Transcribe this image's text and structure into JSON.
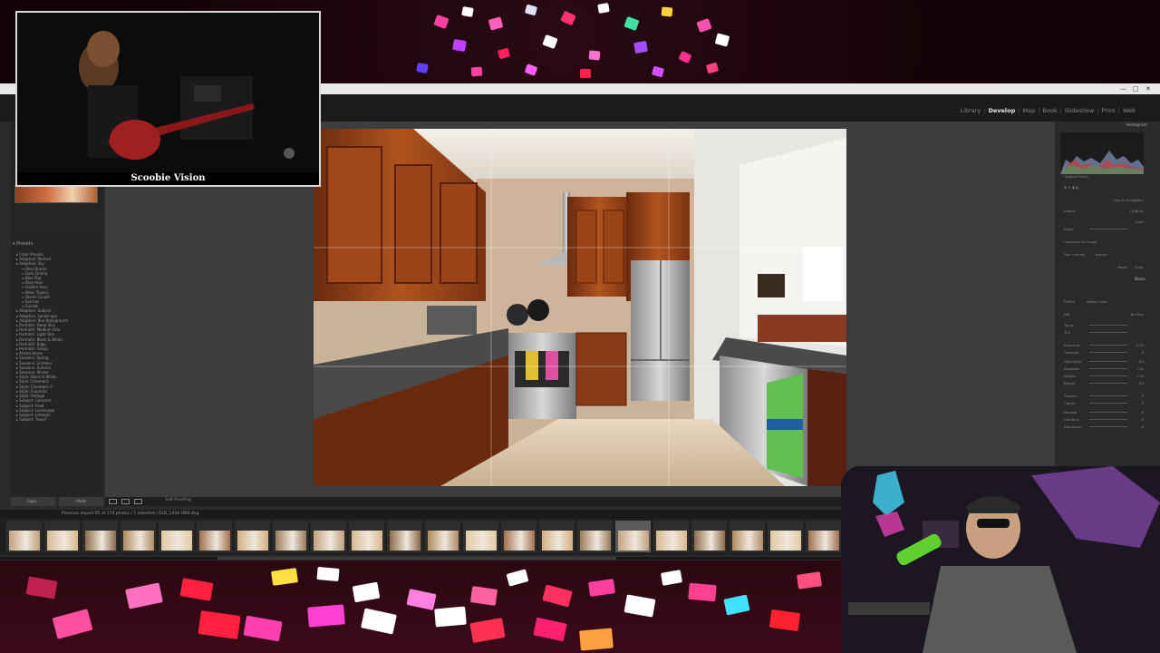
{
  "overlay": {
    "bass_cam_label": "Scoobie Vision"
  },
  "lightroom": {
    "modules": [
      {
        "label": "Library",
        "active": false
      },
      {
        "label": "Develop",
        "active": true
      },
      {
        "label": "Map",
        "active": false
      },
      {
        "label": "Book",
        "active": false
      },
      {
        "label": "Slideshow",
        "active": false
      },
      {
        "label": "Print",
        "active": false
      },
      {
        "label": "Web",
        "active": false
      }
    ],
    "left_panel": {
      "presets_header": "Presets",
      "presets": [
        {
          "label": "Color Presets",
          "sub": false
        },
        {
          "label": "Adaptive: Portrait",
          "sub": false
        },
        {
          "label": "Adaptive: Sky",
          "sub": false
        },
        {
          "label": "Blue Drama",
          "sub": true
        },
        {
          "label": "Dark Drama",
          "sub": true
        },
        {
          "label": "Blue Pop",
          "sub": true
        },
        {
          "label": "Blue Hour",
          "sub": true
        },
        {
          "label": "Golden Hour",
          "sub": true
        },
        {
          "label": "Neon Tropics",
          "sub": true
        },
        {
          "label": "Storm Clouds",
          "sub": true
        },
        {
          "label": "Sunrise",
          "sub": true
        },
        {
          "label": "Sunset",
          "sub": true
        },
        {
          "label": "Adaptive: Subject",
          "sub": false
        },
        {
          "label": "Adaptive: Landscape",
          "sub": false
        },
        {
          "label": "Adaptive: Blur Background",
          "sub": false
        },
        {
          "label": "Portraits: Deep Skin",
          "sub": false
        },
        {
          "label": "Portraits: Medium Skin",
          "sub": false
        },
        {
          "label": "Portraits: Light Skin",
          "sub": false
        },
        {
          "label": "Portraits: Black & White",
          "sub": false
        },
        {
          "label": "Portraits: Edgy",
          "sub": false
        },
        {
          "label": "Portraits: Group",
          "sub": false
        },
        {
          "label": "Annex Home",
          "sub": false
        },
        {
          "label": "Seasons: Spring",
          "sub": false
        },
        {
          "label": "Seasons: Summer",
          "sub": false
        },
        {
          "label": "Seasons: Autumn",
          "sub": false
        },
        {
          "label": "Seasons: Winter",
          "sub": false
        },
        {
          "label": "Style: Black & White",
          "sub": false
        },
        {
          "label": "Style: Cinematic",
          "sub": false
        },
        {
          "label": "Style: Cinematic II",
          "sub": false
        },
        {
          "label": "Style: Futuristic",
          "sub": false
        },
        {
          "label": "Style: Vintage",
          "sub": false
        },
        {
          "label": "Subject: Concerts",
          "sub": false
        },
        {
          "label": "Subject: Food",
          "sub": false
        },
        {
          "label": "Subject: Landscape",
          "sub": false
        },
        {
          "label": "Subject: Lifestyle",
          "sub": false
        },
        {
          "label": "Subject: Travel",
          "sub": false
        }
      ],
      "copy_label": "Copy...",
      "paste_label": "Paste"
    },
    "toolbar": {
      "soft_proofing_label": "Soft Proofing"
    },
    "right_panel": {
      "histogram_header": "Histogram",
      "original_photo_label": "Original Photo",
      "crop_label": "Crop & Straighten",
      "aspect_label": "Aspect",
      "aspect_value": "Original",
      "angle_label": "Angle",
      "auto_label": "Auto",
      "constrain_label": "Constrain to Image",
      "tool_overlay_label": "Tool Overlay",
      "tool_overlay_value": "Always",
      "reset_label": "Reset",
      "close_label": "Close",
      "basic_header": "Basic",
      "profile_label": "Profile",
      "profile_value": "Adobe Color",
      "wb_label": "WB",
      "wb_value": "As Shot",
      "tone_label": "Tone",
      "presence_label": "Presence",
      "sliders": [
        {
          "label": "Temp",
          "value": ""
        },
        {
          "label": "Tint",
          "value": ""
        },
        {
          "label": "Exposure",
          "value": "0.00"
        },
        {
          "label": "Contrast",
          "value": "0"
        },
        {
          "label": "Highlights",
          "value": "-24"
        },
        {
          "label": "Shadows",
          "value": "+41"
        },
        {
          "label": "Whites",
          "value": "+19"
        },
        {
          "label": "Blacks",
          "value": "-24"
        },
        {
          "label": "Texture",
          "value": "0"
        },
        {
          "label": "Clarity",
          "value": "0"
        },
        {
          "label": "Dehaze",
          "value": "0"
        },
        {
          "label": "Vibrance",
          "value": "0"
        },
        {
          "label": "Saturation",
          "value": "0"
        }
      ],
      "tone_curve_header": "Tone Curve",
      "color_mixer_header": "Color Mixer",
      "split_toning_header": "Split Toning"
    },
    "filmstrip": {
      "info": "Previous Import     65 of 174 photos / 1 selected / DLB_1434-HDR.dng",
      "active_index": 16,
      "count": 22
    }
  }
}
